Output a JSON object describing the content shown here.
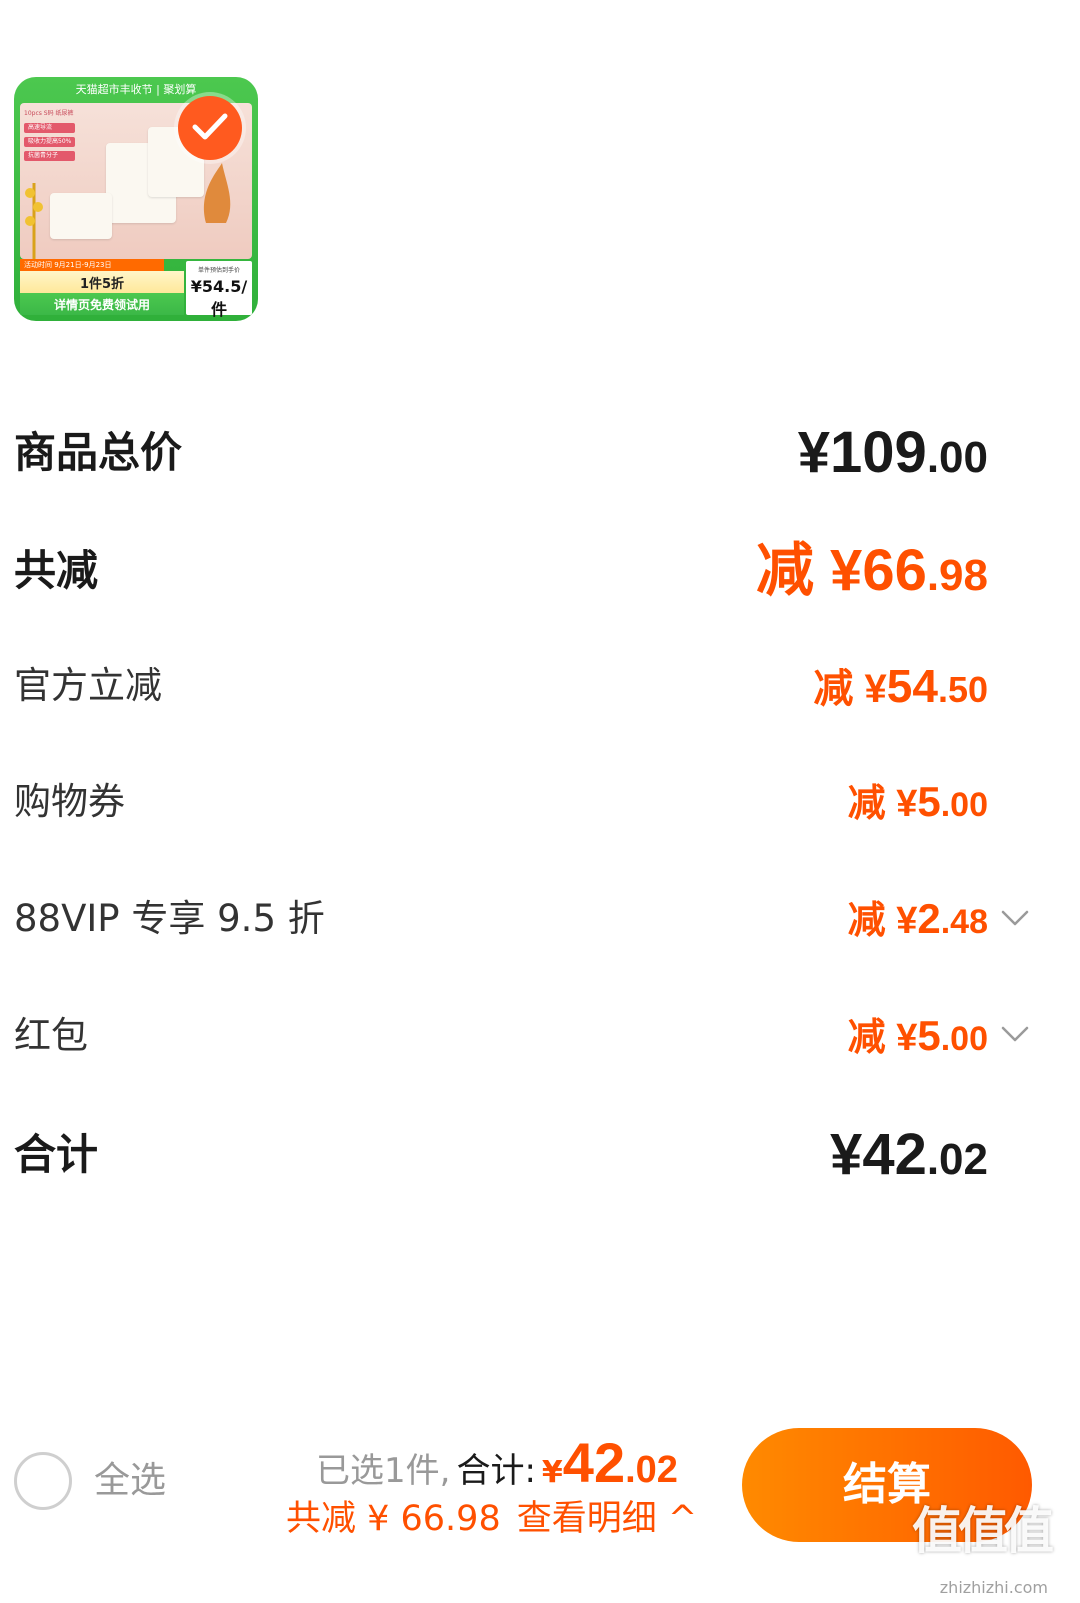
{
  "product": {
    "thumb_header": "天猫超市丰收节 | 聚划算",
    "thumb_features": [
      "10pcs S码 纸尿裤",
      "高速导流",
      "吸收力提高50%",
      "抗菌青分子"
    ],
    "thumb_date": "活动时间 9月21日-9月23日",
    "thumb_deal": "1件5折",
    "thumb_trial": "详情页免费领试用",
    "thumb_unit_caption": "单件预估到手价",
    "thumb_unit_price": "¥54.5/件",
    "selected": true
  },
  "summary": {
    "total_label": "商品总价",
    "total_prefix": "¥",
    "total_int": "109",
    "total_dec": ".00",
    "discount_label": "共减",
    "discount_prefix": "减 ¥",
    "discount_int": "66",
    "discount_dec": ".98",
    "official_label": "官方立减",
    "official_prefix": "减 ¥",
    "official_int": "54",
    "official_dec": ".50",
    "coupon_label": "购物券",
    "coupon_prefix": "减 ¥",
    "coupon_int": "5",
    "coupon_dec": ".00",
    "vip_label": "88VIP 专享 9.5 折",
    "vip_prefix": "减 ¥",
    "vip_int": "2",
    "vip_dec": ".48",
    "redpacket_label": "红包",
    "redpacket_prefix": "减 ¥",
    "redpacket_int": "5",
    "redpacket_dec": ".00",
    "grand_label": "合计",
    "grand_prefix": "¥",
    "grand_int": "42",
    "grand_dec": ".02"
  },
  "bottom_bar": {
    "select_all": "全选",
    "selected_count": "已选1件,",
    "total_label": "合计:",
    "total_yen": "¥",
    "total_int": "42",
    "total_dec": ".02",
    "discount_text": "共减 ¥ 66.98",
    "detail_text": "查看明细 ^",
    "checkout": "结算"
  },
  "watermark": {
    "logo": "值值值",
    "url": "zhizhizhi.com"
  },
  "colors": {
    "accent": "#ff5000",
    "checkout_start": "#ff8a00",
    "checkout_end": "#ff5a00",
    "thumb_green": "#3bb847"
  }
}
